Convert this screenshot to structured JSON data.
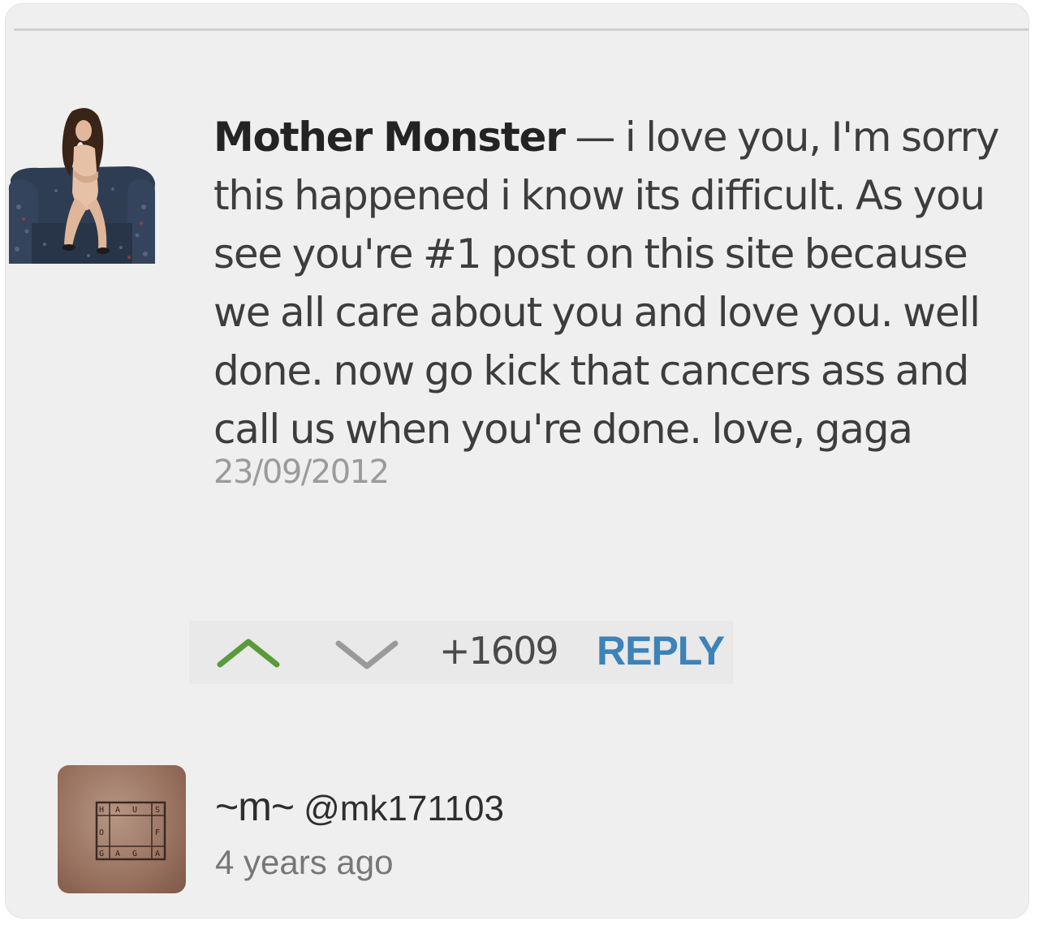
{
  "comment": {
    "author": "Mother Monster",
    "separator": " — ",
    "text": "i love you, I'm sorry this happened i know its difficult. As you see you're #1 post on this site because we all care about you and love you. well done. now go kick that cancers ass and call us when you're done. love, gaga",
    "date": "23/09/2012",
    "avatar_icon": "woman-on-sofa-photo"
  },
  "actions": {
    "upvote_icon": "chevron-up-icon",
    "downvote_icon": "chevron-down-icon",
    "score": "+1609",
    "reply_label": "REPLY",
    "upvote_color": "#5a9a3a",
    "downvote_color": "#9a9a9a",
    "reply_color": "#3d82b8"
  },
  "post": {
    "display_name": "~m~",
    "handle": "@mk171103",
    "time": "4 years ago",
    "avatar_text": [
      "H",
      "A",
      "U",
      "S",
      "O",
      "F",
      "G",
      "A",
      "G",
      "A"
    ]
  }
}
